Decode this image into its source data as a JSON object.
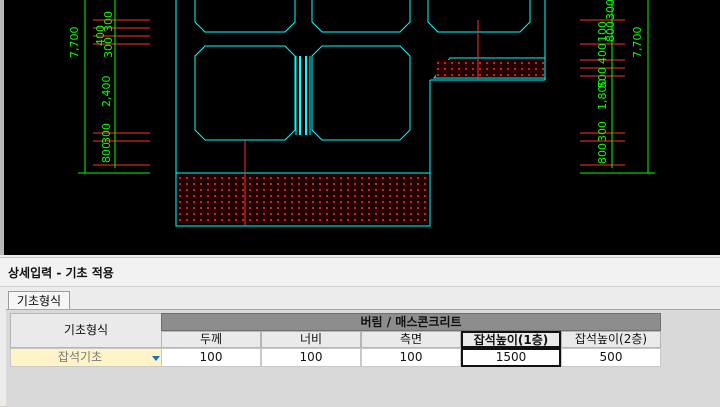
{
  "drawing": {
    "dims_left": [
      "7,700",
      "400",
      "300",
      "300",
      "2,400",
      "800",
      "300"
    ],
    "dims_right": [
      "100",
      "400",
      "500",
      "800",
      "300",
      "7,700",
      "1,800",
      "800",
      "300"
    ]
  },
  "panel": {
    "title": "상세입력 - 기초 적용"
  },
  "tab": {
    "label": "기초형식"
  },
  "table": {
    "row_header": "기초형식",
    "group_header": "버림 / 매스콘크리트",
    "columns": [
      "두께",
      "너비",
      "측면",
      "잡석높이(1층)",
      "잡석높이(2층)"
    ],
    "type_value": "잡석기초",
    "values": [
      "100",
      "100",
      "100",
      "1500",
      "500"
    ]
  },
  "colors": {
    "cad_bg": "#000000",
    "cyan": "#00ffff",
    "red": "#ff0000",
    "green": "#00ff00"
  }
}
